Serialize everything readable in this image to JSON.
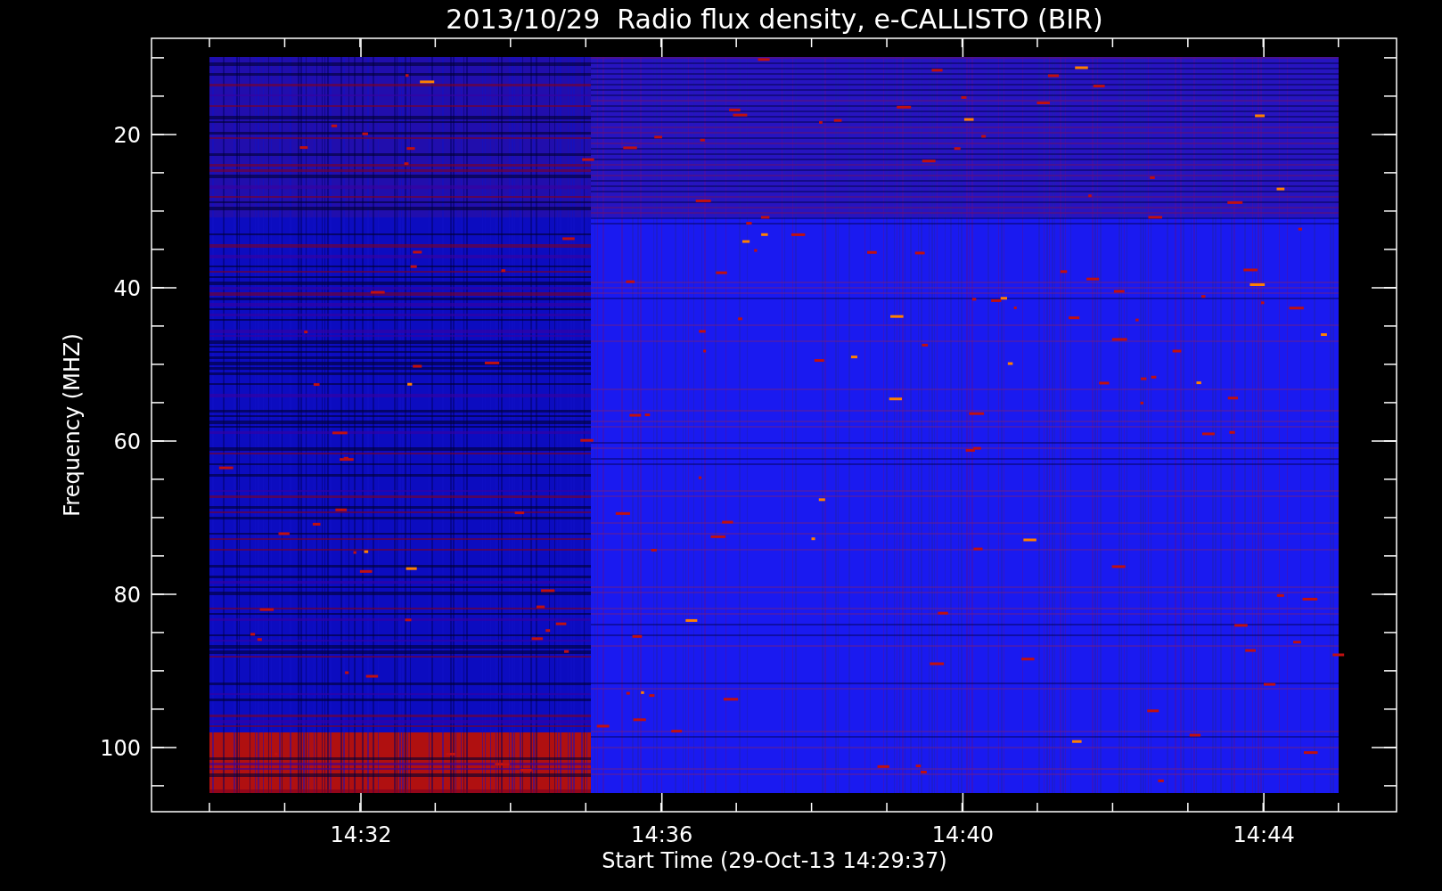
{
  "title": "2013/10/29  Radio flux density, e-CALLISTO (BIR)",
  "y_axis": {
    "label": "Frequency (MHZ)",
    "ticks": [
      "20",
      "40",
      "60",
      "80",
      "100"
    ]
  },
  "x_axis": {
    "label": "Start Time (29-Oct-13 14:29:37)",
    "ticks": [
      "14:32",
      "14:36",
      "14:40",
      "14:44"
    ]
  }
}
